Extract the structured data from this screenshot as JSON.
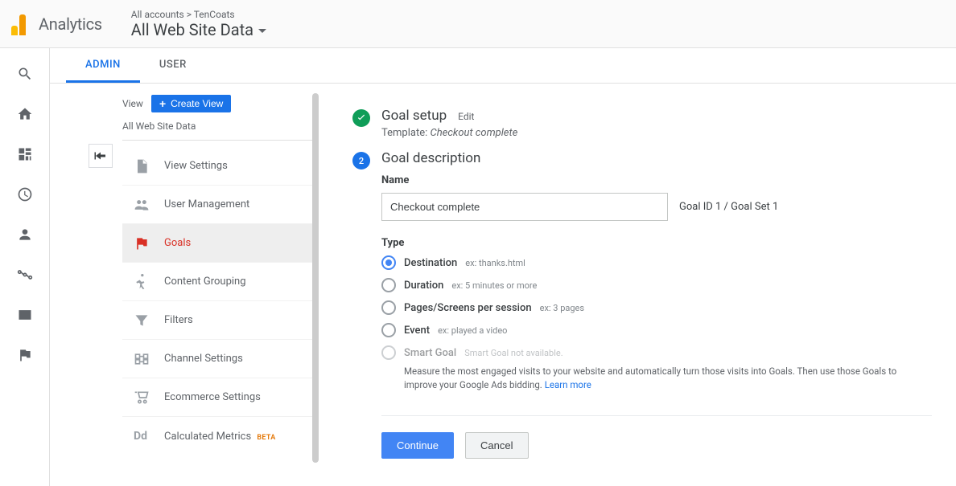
{
  "header": {
    "product": "Analytics",
    "breadcrumb": "All accounts > TenCoats",
    "view_selector": "All Web Site Data"
  },
  "tabs": {
    "admin": "ADMIN",
    "user": "USER"
  },
  "admin_panel": {
    "view_label": "View",
    "create_view": "Create View",
    "current_view": "All Web Site Data",
    "items": [
      {
        "label": "View Settings",
        "icon": "file"
      },
      {
        "label": "User Management",
        "icon": "people"
      },
      {
        "label": "Goals",
        "icon": "flag"
      },
      {
        "label": "Content Grouping",
        "icon": "person-run"
      },
      {
        "label": "Filters",
        "icon": "funnel"
      },
      {
        "label": "Channel Settings",
        "icon": "channel"
      },
      {
        "label": "Ecommerce Settings",
        "icon": "cart"
      },
      {
        "label": "Calculated Metrics",
        "icon": "dd",
        "beta": "BETA"
      }
    ]
  },
  "form": {
    "step1_title": "Goal setup",
    "edit": "Edit",
    "template_label": "Template:",
    "template_value": "Checkout complete",
    "step2_num": "2",
    "step2_title": "Goal description",
    "name_label": "Name",
    "name_value": "Checkout complete",
    "goal_id": "Goal ID 1 / Goal Set 1",
    "type_label": "Type",
    "type_options": [
      {
        "label": "Destination",
        "hint": "ex: thanks.html",
        "selected": true
      },
      {
        "label": "Duration",
        "hint": "ex: 5 minutes or more",
        "selected": false
      },
      {
        "label": "Pages/Screens per session",
        "hint": "ex: 3 pages",
        "selected": false
      },
      {
        "label": "Event",
        "hint": "ex: played a video",
        "selected": false
      },
      {
        "label": "Smart Goal",
        "hint": "Smart Goal not available.",
        "selected": false,
        "disabled": true
      }
    ],
    "smart_desc": "Measure the most engaged visits to your website and automatically turn those visits into Goals. Then use those Goals to improve your Google Ads bidding.",
    "learn_more": "Learn more",
    "continue": "Continue",
    "cancel": "Cancel"
  }
}
